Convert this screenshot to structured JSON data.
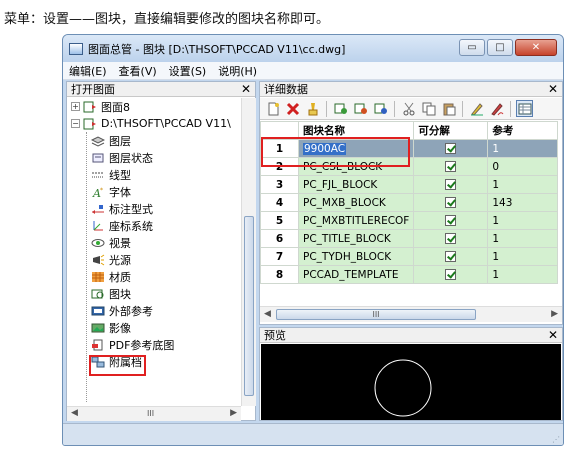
{
  "caption": "菜单：设置——图块，直接编辑要修改的图块名称即可。",
  "window": {
    "title": "图面总管 - 图块 [D:\\THSOFT\\PCCAD V11\\cc.dwg]",
    "buttons": {
      "minimize": "▭",
      "maximize": "□",
      "close": "✕"
    }
  },
  "menu": [
    "编辑(E)",
    "查看(V)",
    "设置(S)",
    "说明(H)"
  ],
  "left_pane": {
    "title": "打开图面",
    "close": "✕",
    "tree": [
      {
        "label": "图面8",
        "icon": "drawing-icon"
      },
      {
        "label": "D:\\THSOFT\\PCCAD V11\\",
        "icon": "drawing-icon"
      },
      {
        "label": "图层",
        "icon": "layer-icon"
      },
      {
        "label": "图层状态",
        "icon": "layer-state-icon"
      },
      {
        "label": "线型",
        "icon": "linetype-icon"
      },
      {
        "label": "字体",
        "icon": "font-icon"
      },
      {
        "label": "标注型式",
        "icon": "dimension-style-icon"
      },
      {
        "label": "座标系统",
        "icon": "ucs-icon"
      },
      {
        "label": "视景",
        "icon": "view-icon"
      },
      {
        "label": "光源",
        "icon": "light-icon"
      },
      {
        "label": "材质",
        "icon": "material-icon"
      },
      {
        "label": "图块",
        "icon": "block-icon"
      },
      {
        "label": "外部参考",
        "icon": "xref-icon"
      },
      {
        "label": "影像",
        "icon": "image-icon"
      },
      {
        "label": "PDF参考底图",
        "icon": "pdf-underlay-icon"
      },
      {
        "label": "附属档",
        "icon": "attachment-icon"
      }
    ],
    "hscroll_mark": "III"
  },
  "right_pane": {
    "title": "详细数据",
    "close": "✕",
    "columns": [
      "图块名称",
      "可分解",
      "参考"
    ],
    "rows": [
      {
        "num": "1",
        "name": "9900AC",
        "ref": "1"
      },
      {
        "num": "2",
        "name": "PC_CSL_BLOCK",
        "ref": "0"
      },
      {
        "num": "3",
        "name": "PC_FJL_BLOCK",
        "ref": "1"
      },
      {
        "num": "4",
        "name": "PC_MXB_BLOCK",
        "ref": "143"
      },
      {
        "num": "5",
        "name": "PC_MXBTITLERECOF",
        "ref": "1"
      },
      {
        "num": "6",
        "name": "PC_TITLE_BLOCK",
        "ref": "1"
      },
      {
        "num": "7",
        "name": "PC_TYDH_BLOCK",
        "ref": "1"
      },
      {
        "num": "8",
        "name": "PCCAD_TEMPLATE",
        "ref": "1"
      }
    ],
    "hscroll_mark": "III"
  },
  "preview": {
    "title": "预览",
    "close": "✕"
  }
}
